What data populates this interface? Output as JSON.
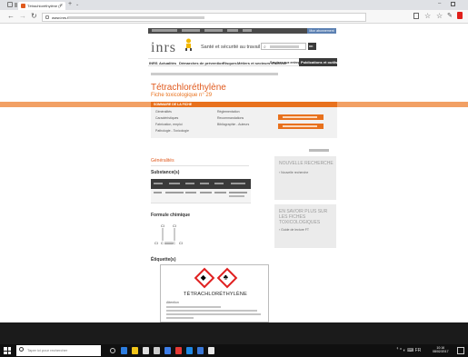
{
  "browser": {
    "tab_title": "Tétrachloréthylène (F",
    "tab_close": "×",
    "new_tab": "+",
    "tab_dropdown": "⌄",
    "url_domain": "www.inrs.fr",
    "back_glyph": "←",
    "forward_glyph": "→",
    "reload_glyph": "↻",
    "fav_glyph": "☆",
    "hub_glyph": "☆",
    "pen_glyph": "✎",
    "min_glyph": "–"
  },
  "site": {
    "logo": "inrs",
    "tagline": "Santé et sécurité au travail",
    "search_button": "OK",
    "topstrip_button": "Mon abonnement"
  },
  "main_nav": {
    "items": [
      "INRS",
      "Actualités",
      "Démarches de prévention",
      "Risques",
      "Métiers et secteurs d'activité",
      "Services aux entreprises"
    ],
    "active": "Publications et outils"
  },
  "page": {
    "title": "Tétrachloréthylène",
    "subtitle": "Fiche toxicologique n° 29",
    "summary_title": "SOMMAIRE DE LA FICHE",
    "summary_col1": [
      "Généralités",
      "Caractéristiques",
      "Fabrication, emploi",
      "Pathologie - Toxicologie"
    ],
    "summary_col2": [
      "Réglementation",
      "Recommandations",
      "Bibliographie - Auteurs"
    ],
    "section_generalites": "Généralités",
    "section_substances": "Substance(s)",
    "section_formule": "Formule chimique",
    "section_etiquette": "Étiquette(s)"
  },
  "formula": {
    "cl1": "Cl",
    "cl2": "Cl",
    "cl3": "Cl",
    "cl4": "Cl",
    "c1": "C",
    "c2": "C"
  },
  "label_card": {
    "name": "TÉTRACHLORÉTHYLÈNE",
    "signal_word": "Attention",
    "pictograms": [
      "health-hazard",
      "environment"
    ],
    "health_glyph": "◆",
    "env_glyph": "♣"
  },
  "sidebar": {
    "box1_title": "NOUVELLE RECHERCHE",
    "box1_link": "› Nouvelle recherche",
    "box2_title": "EN SAVOIR PLUS SUR LES FICHES TOXICOLOGIQUES",
    "box2_link": "› Guide de lecture FT"
  },
  "taskbar": {
    "search_placeholder": "Taper ici pour rechercher",
    "clock_time": "10:16",
    "clock_date": "08/02/2017",
    "tray": "ꜛ ^ ◐ ⌨ FR"
  },
  "colors": {
    "accent_orange": "#e8711d",
    "title_orange": "#e05a1e",
    "nav_dark": "#3a3a3a"
  }
}
